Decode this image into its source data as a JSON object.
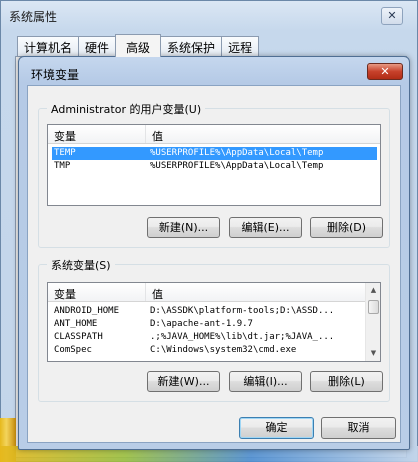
{
  "outer_window": {
    "title": "系统属性",
    "tabs": [
      "计算机名",
      "硬件",
      "高级",
      "系统保护",
      "远程"
    ],
    "active_tab": "高级"
  },
  "dialog": {
    "title": "环境变量",
    "user_vars": {
      "label": "Administrator 的用户变量(U)",
      "col_name": "变量",
      "col_value": "值",
      "rows": [
        {
          "name": "TEMP",
          "value": "%USERPROFILE%\\AppData\\Local\\Temp"
        },
        {
          "name": "TMP",
          "value": "%USERPROFILE%\\AppData\\Local\\Temp"
        }
      ],
      "selected_row": "TEMP",
      "buttons": {
        "new": "新建(N)...",
        "edit": "编辑(E)...",
        "delete": "删除(D)"
      }
    },
    "system_vars": {
      "label": "系统变量(S)",
      "col_name": "变量",
      "col_value": "值",
      "rows": [
        {
          "name": "ANDROID_HOME",
          "value": "D:\\ASSDK\\platform-tools;D:\\ASSD..."
        },
        {
          "name": "ANT_HOME",
          "value": "D:\\apache-ant-1.9.7"
        },
        {
          "name": "CLASSPATH",
          "value": ".;%JAVA_HOME%\\lib\\dt.jar;%JAVA_..."
        },
        {
          "name": "ComSpec",
          "value": "C:\\Windows\\system32\\cmd.exe"
        }
      ],
      "buttons": {
        "new": "新建(W)...",
        "edit": "编辑(I)...",
        "delete": "删除(L)"
      }
    },
    "ok": "确定",
    "cancel": "取消"
  },
  "colors": {
    "selection": "#3399ff",
    "close_button": "#c7412b"
  },
  "icons": [
    "close-icon",
    "scroll-up-icon",
    "scroll-down-icon"
  ]
}
